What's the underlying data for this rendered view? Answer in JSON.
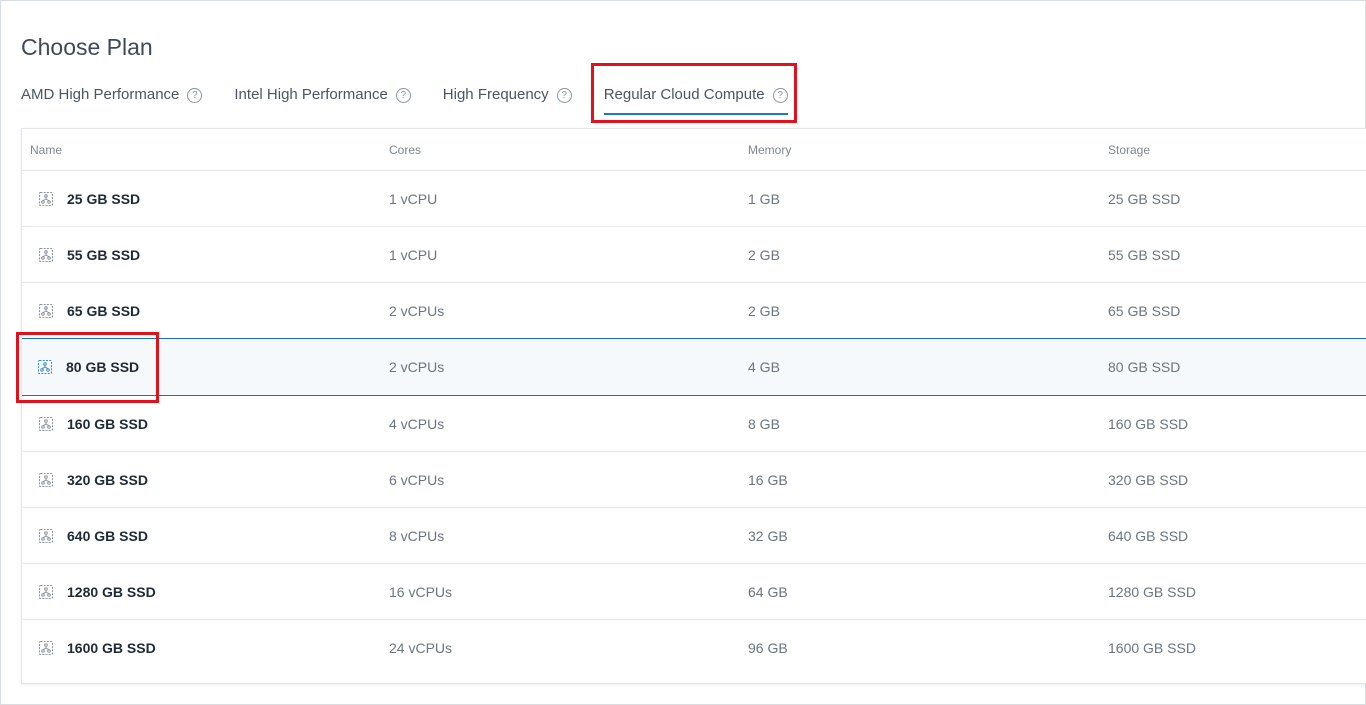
{
  "page": {
    "title": "Choose Plan"
  },
  "tabs": [
    {
      "label": "AMD High Performance",
      "active": false
    },
    {
      "label": "Intel High Performance",
      "active": false
    },
    {
      "label": "High Frequency",
      "active": false
    },
    {
      "label": "Regular Cloud Compute",
      "active": true
    }
  ],
  "table": {
    "headers": {
      "name": "Name",
      "cores": "Cores",
      "memory": "Memory",
      "storage": "Storage"
    },
    "rows": [
      {
        "name": "25 GB SSD",
        "cores": "1 vCPU",
        "memory": "1 GB",
        "storage": "25 GB SSD",
        "selected": false
      },
      {
        "name": "55 GB SSD",
        "cores": "1 vCPU",
        "memory": "2 GB",
        "storage": "55 GB SSD",
        "selected": false
      },
      {
        "name": "65 GB SSD",
        "cores": "2 vCPUs",
        "memory": "2 GB",
        "storage": "65 GB SSD",
        "selected": false
      },
      {
        "name": "80 GB SSD",
        "cores": "2 vCPUs",
        "memory": "4 GB",
        "storage": "80 GB SSD",
        "selected": true
      },
      {
        "name": "160 GB SSD",
        "cores": "4 vCPUs",
        "memory": "8 GB",
        "storage": "160 GB SSD",
        "selected": false
      },
      {
        "name": "320 GB SSD",
        "cores": "6 vCPUs",
        "memory": "16 GB",
        "storage": "320 GB SSD",
        "selected": false
      },
      {
        "name": "640 GB SSD",
        "cores": "8 vCPUs",
        "memory": "32 GB",
        "storage": "640 GB SSD",
        "selected": false
      },
      {
        "name": "1280 GB SSD",
        "cores": "16 vCPUs",
        "memory": "64 GB",
        "storage": "1280 GB SSD",
        "selected": false
      },
      {
        "name": "1600 GB SSD",
        "cores": "24 vCPUs",
        "memory": "96 GB",
        "storage": "1600 GB SSD",
        "selected": false
      }
    ]
  },
  "icons": {
    "tab_help": "help-circle-icon",
    "plan": "server-chip-icon",
    "help_glyph": "?"
  },
  "colors": {
    "accent": "#1e78c9",
    "selected_row_border": "#1d6fb8",
    "selected_icon": "#3d8ccc",
    "icon_default": "#8a939c",
    "annotation": "#e0121e"
  }
}
